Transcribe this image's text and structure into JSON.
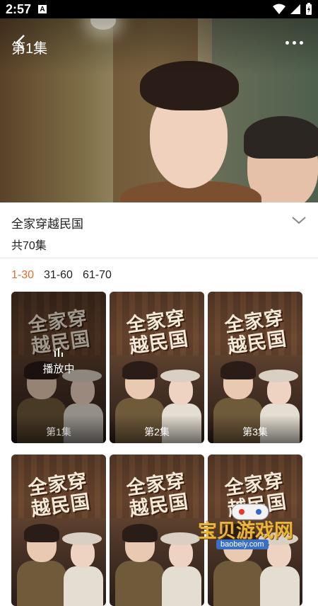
{
  "status_bar": {
    "time": "2:57",
    "notification_letter": "A",
    "icons": [
      "wifi-icon",
      "signal-icon",
      "battery-charging-icon"
    ]
  },
  "video": {
    "episode_title": "第1集",
    "icons": [
      "back-arrow-icon",
      "more-dots-icon"
    ]
  },
  "drama": {
    "title": "全家穿越民国",
    "episode_count": "共70集",
    "expand_icon": "chevron-down-icon"
  },
  "range_tabs": [
    {
      "label": "1-30",
      "active": true
    },
    {
      "label": "31-60",
      "active": false
    },
    {
      "label": "61-70",
      "active": false
    }
  ],
  "accent_color": "#e8692a",
  "episodes": [
    {
      "poster_title": "全家穿越民国",
      "label": "第1集",
      "playing": true,
      "playing_text": "播放中"
    },
    {
      "poster_title": "全家穿越民国",
      "label": "第2集",
      "playing": false
    },
    {
      "poster_title": "全家穿越民国",
      "label": "第3集",
      "playing": false
    },
    {
      "poster_title": "全家穿越民国",
      "label": "",
      "playing": false
    },
    {
      "poster_title": "全家穿越民国",
      "label": "",
      "playing": false
    },
    {
      "poster_title": "全家穿越民国",
      "label": "",
      "playing": false
    }
  ],
  "watermark": {
    "text": "宝贝游戏网",
    "url": "baobeiy.com"
  }
}
